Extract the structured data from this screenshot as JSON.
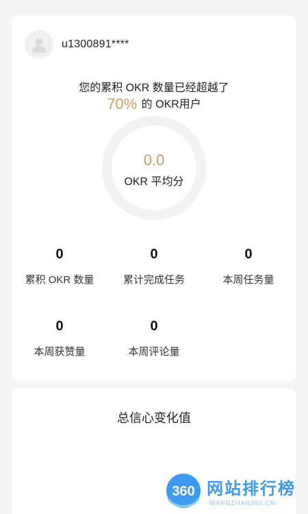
{
  "user": {
    "name": "u1300891****"
  },
  "summary": {
    "line1": "您的累积 OKR 数量已经超越了",
    "percent": "70%",
    "line2_suffix": " 的 OKR用户"
  },
  "ring": {
    "value": "0.0",
    "label": "OKR 平均分"
  },
  "stats": [
    {
      "value": "0",
      "label": "累积 OKR 数量"
    },
    {
      "value": "0",
      "label": "累计完成任务"
    },
    {
      "value": "0",
      "label": "本周任务量"
    },
    {
      "value": "0",
      "label": "本周获赞量"
    },
    {
      "value": "0",
      "label": "本周评论量"
    }
  ],
  "chart": {
    "title": "总信心变化值"
  },
  "watermark": {
    "badge": "360",
    "main": "网站排行榜",
    "sub": "-WANGZHAN360.CN-"
  },
  "colors": {
    "accent": "#c9a062",
    "ring": "#f2f2f2",
    "card": "#ffffff",
    "background": "#f5f5f5"
  }
}
